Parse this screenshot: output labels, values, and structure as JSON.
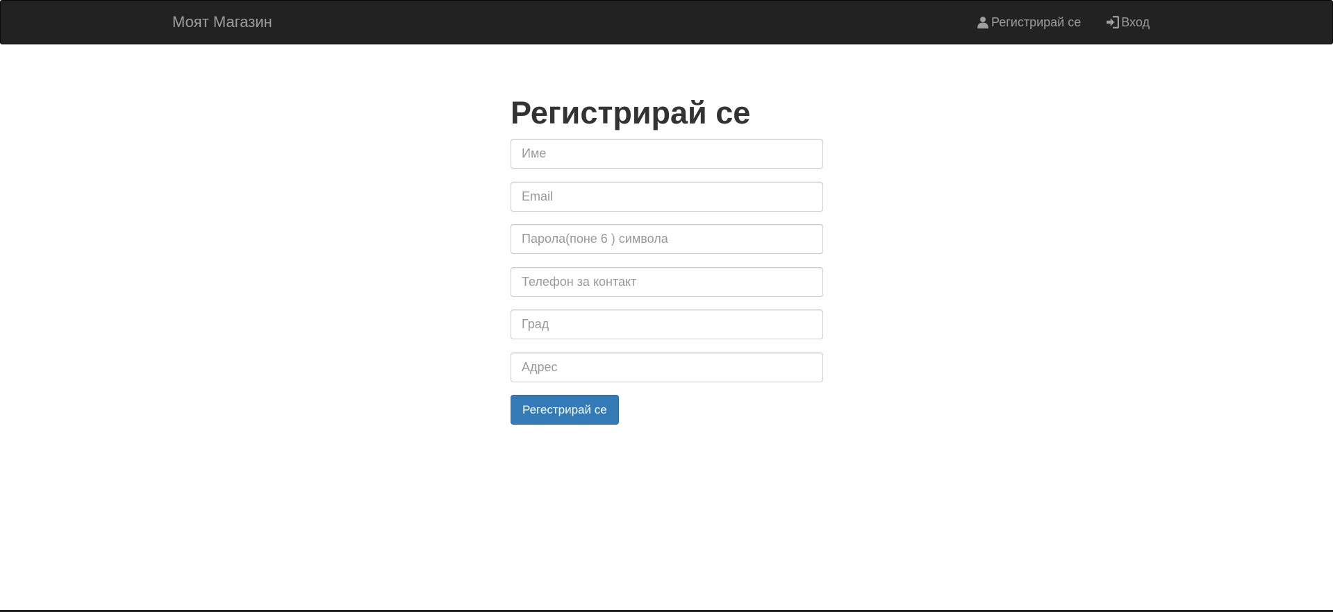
{
  "navbar": {
    "brand": "Моят Магазин",
    "links": [
      {
        "label": "Регистрирай се",
        "icon": "user-icon"
      },
      {
        "label": "Вход",
        "icon": "log-in-icon"
      }
    ]
  },
  "main": {
    "title": "Регистрирай се",
    "fields": [
      {
        "placeholder": "Име",
        "value": ""
      },
      {
        "placeholder": "Email",
        "value": ""
      },
      {
        "placeholder": "Парола(поне 6 ) символа",
        "value": ""
      },
      {
        "placeholder": "Телефон за контакт",
        "value": ""
      },
      {
        "placeholder": "Град",
        "value": ""
      },
      {
        "placeholder": "Адрес",
        "value": ""
      }
    ],
    "submit_label": "Регестрирай се"
  },
  "colors": {
    "navbar_bg": "#222222",
    "nav_text": "#9d9d9d",
    "primary": "#337ab7"
  }
}
